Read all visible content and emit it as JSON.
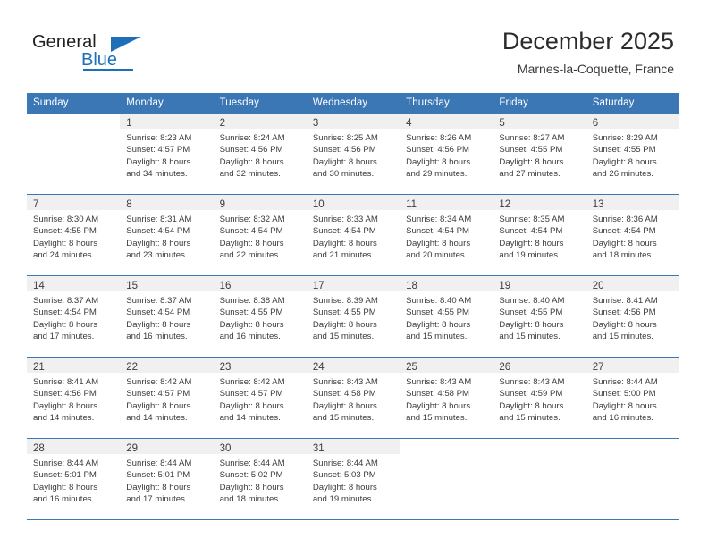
{
  "brand": {
    "word_one": "General",
    "word_two": "Blue",
    "triangle_icon": "triangle-icon",
    "accent_color": "#1d70b8"
  },
  "header": {
    "title": "December 2025",
    "subtitle": "Marnes-la-Coquette, France"
  },
  "theme": {
    "header_bg": "#3b77b5",
    "daynum_band_bg": "#f0f0f0",
    "grid_line": "#3b77b5",
    "text": "#3b3b3b"
  },
  "weekdays": [
    "Sunday",
    "Monday",
    "Tuesday",
    "Wednesday",
    "Thursday",
    "Friday",
    "Saturday"
  ],
  "weeks": [
    [
      {
        "day": "",
        "lines": []
      },
      {
        "day": "1",
        "lines": [
          "Sunrise: 8:23 AM",
          "Sunset: 4:57 PM",
          "Daylight: 8 hours",
          "and 34 minutes."
        ]
      },
      {
        "day": "2",
        "lines": [
          "Sunrise: 8:24 AM",
          "Sunset: 4:56 PM",
          "Daylight: 8 hours",
          "and 32 minutes."
        ]
      },
      {
        "day": "3",
        "lines": [
          "Sunrise: 8:25 AM",
          "Sunset: 4:56 PM",
          "Daylight: 8 hours",
          "and 30 minutes."
        ]
      },
      {
        "day": "4",
        "lines": [
          "Sunrise: 8:26 AM",
          "Sunset: 4:56 PM",
          "Daylight: 8 hours",
          "and 29 minutes."
        ]
      },
      {
        "day": "5",
        "lines": [
          "Sunrise: 8:27 AM",
          "Sunset: 4:55 PM",
          "Daylight: 8 hours",
          "and 27 minutes."
        ]
      },
      {
        "day": "6",
        "lines": [
          "Sunrise: 8:29 AM",
          "Sunset: 4:55 PM",
          "Daylight: 8 hours",
          "and 26 minutes."
        ]
      }
    ],
    [
      {
        "day": "7",
        "lines": [
          "Sunrise: 8:30 AM",
          "Sunset: 4:55 PM",
          "Daylight: 8 hours",
          "and 24 minutes."
        ]
      },
      {
        "day": "8",
        "lines": [
          "Sunrise: 8:31 AM",
          "Sunset: 4:54 PM",
          "Daylight: 8 hours",
          "and 23 minutes."
        ]
      },
      {
        "day": "9",
        "lines": [
          "Sunrise: 8:32 AM",
          "Sunset: 4:54 PM",
          "Daylight: 8 hours",
          "and 22 minutes."
        ]
      },
      {
        "day": "10",
        "lines": [
          "Sunrise: 8:33 AM",
          "Sunset: 4:54 PM",
          "Daylight: 8 hours",
          "and 21 minutes."
        ]
      },
      {
        "day": "11",
        "lines": [
          "Sunrise: 8:34 AM",
          "Sunset: 4:54 PM",
          "Daylight: 8 hours",
          "and 20 minutes."
        ]
      },
      {
        "day": "12",
        "lines": [
          "Sunrise: 8:35 AM",
          "Sunset: 4:54 PM",
          "Daylight: 8 hours",
          "and 19 minutes."
        ]
      },
      {
        "day": "13",
        "lines": [
          "Sunrise: 8:36 AM",
          "Sunset: 4:54 PM",
          "Daylight: 8 hours",
          "and 18 minutes."
        ]
      }
    ],
    [
      {
        "day": "14",
        "lines": [
          "Sunrise: 8:37 AM",
          "Sunset: 4:54 PM",
          "Daylight: 8 hours",
          "and 17 minutes."
        ]
      },
      {
        "day": "15",
        "lines": [
          "Sunrise: 8:37 AM",
          "Sunset: 4:54 PM",
          "Daylight: 8 hours",
          "and 16 minutes."
        ]
      },
      {
        "day": "16",
        "lines": [
          "Sunrise: 8:38 AM",
          "Sunset: 4:55 PM",
          "Daylight: 8 hours",
          "and 16 minutes."
        ]
      },
      {
        "day": "17",
        "lines": [
          "Sunrise: 8:39 AM",
          "Sunset: 4:55 PM",
          "Daylight: 8 hours",
          "and 15 minutes."
        ]
      },
      {
        "day": "18",
        "lines": [
          "Sunrise: 8:40 AM",
          "Sunset: 4:55 PM",
          "Daylight: 8 hours",
          "and 15 minutes."
        ]
      },
      {
        "day": "19",
        "lines": [
          "Sunrise: 8:40 AM",
          "Sunset: 4:55 PM",
          "Daylight: 8 hours",
          "and 15 minutes."
        ]
      },
      {
        "day": "20",
        "lines": [
          "Sunrise: 8:41 AM",
          "Sunset: 4:56 PM",
          "Daylight: 8 hours",
          "and 15 minutes."
        ]
      }
    ],
    [
      {
        "day": "21",
        "lines": [
          "Sunrise: 8:41 AM",
          "Sunset: 4:56 PM",
          "Daylight: 8 hours",
          "and 14 minutes."
        ]
      },
      {
        "day": "22",
        "lines": [
          "Sunrise: 8:42 AM",
          "Sunset: 4:57 PM",
          "Daylight: 8 hours",
          "and 14 minutes."
        ]
      },
      {
        "day": "23",
        "lines": [
          "Sunrise: 8:42 AM",
          "Sunset: 4:57 PM",
          "Daylight: 8 hours",
          "and 14 minutes."
        ]
      },
      {
        "day": "24",
        "lines": [
          "Sunrise: 8:43 AM",
          "Sunset: 4:58 PM",
          "Daylight: 8 hours",
          "and 15 minutes."
        ]
      },
      {
        "day": "25",
        "lines": [
          "Sunrise: 8:43 AM",
          "Sunset: 4:58 PM",
          "Daylight: 8 hours",
          "and 15 minutes."
        ]
      },
      {
        "day": "26",
        "lines": [
          "Sunrise: 8:43 AM",
          "Sunset: 4:59 PM",
          "Daylight: 8 hours",
          "and 15 minutes."
        ]
      },
      {
        "day": "27",
        "lines": [
          "Sunrise: 8:44 AM",
          "Sunset: 5:00 PM",
          "Daylight: 8 hours",
          "and 16 minutes."
        ]
      }
    ],
    [
      {
        "day": "28",
        "lines": [
          "Sunrise: 8:44 AM",
          "Sunset: 5:01 PM",
          "Daylight: 8 hours",
          "and 16 minutes."
        ]
      },
      {
        "day": "29",
        "lines": [
          "Sunrise: 8:44 AM",
          "Sunset: 5:01 PM",
          "Daylight: 8 hours",
          "and 17 minutes."
        ]
      },
      {
        "day": "30",
        "lines": [
          "Sunrise: 8:44 AM",
          "Sunset: 5:02 PM",
          "Daylight: 8 hours",
          "and 18 minutes."
        ]
      },
      {
        "day": "31",
        "lines": [
          "Sunrise: 8:44 AM",
          "Sunset: 5:03 PM",
          "Daylight: 8 hours",
          "and 19 minutes."
        ]
      },
      {
        "day": "",
        "lines": []
      },
      {
        "day": "",
        "lines": []
      },
      {
        "day": "",
        "lines": []
      }
    ]
  ]
}
